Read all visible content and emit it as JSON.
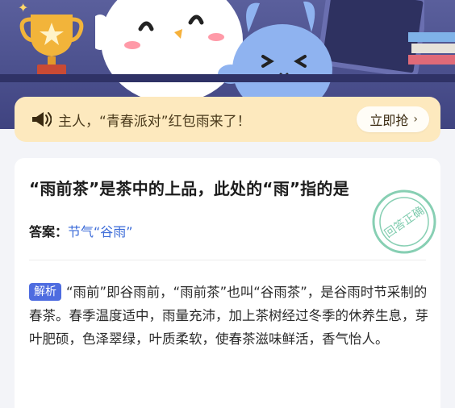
{
  "banner": {
    "text": "主人，“青春派对”红包雨来了！",
    "button_label": "立即抢",
    "icon": "megaphone-icon"
  },
  "card": {
    "question": "“雨前茶”是茶中的上品，此处的“雨”指的是",
    "answer_label": "答案：",
    "answer_value": "节气“谷雨”",
    "stamp_text": "回答正确",
    "analysis_tag": "解析",
    "analysis_text": "“雨前”即谷雨前，“雨前茶”也叫“谷雨茶”，是谷雨时节采制的春茶。春季温度适中，雨量充沛，加上茶树经过冬季的休养生息，芽叶肥硕，色泽翠绿，叶质柔软，使春茶滋味鲜活，香气怡人。"
  },
  "colors": {
    "hero_bg": "#4a4f8c",
    "banner_bg": "#fde9be",
    "answer_accent": "#3b6bd8",
    "tag_bg": "#4e6ce0",
    "stamp": "#5fbf9a"
  }
}
